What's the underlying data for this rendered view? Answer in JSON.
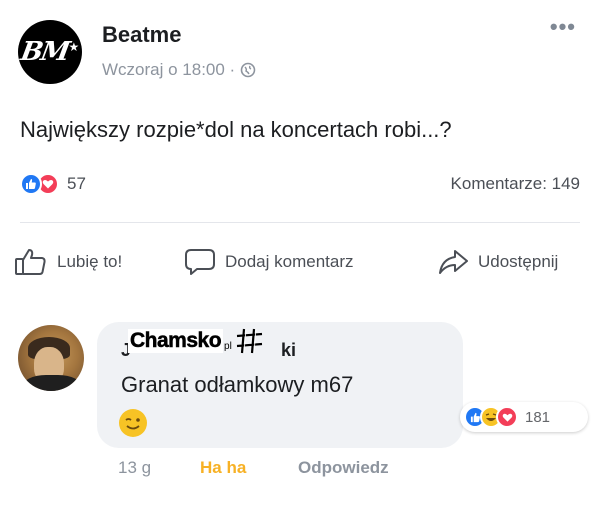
{
  "post": {
    "page_name": "Beatme",
    "logo_text": "BM",
    "timestamp": "Wczoraj o 18:00 ·",
    "text": "Największy rozpie*dol na koncertach robi...?",
    "reaction_count": "57",
    "comments_label": "Komentarze: 149",
    "more_label": "•••"
  },
  "actions": {
    "like": "Lubię to!",
    "comment": "Dodaj komentarz",
    "share": "Udostępnij"
  },
  "comment": {
    "author_prefix": "J",
    "author_suffix": "ki",
    "watermark": "Chamsko",
    "watermark_suffix": "pl",
    "text": "Granat odłamkowy m67",
    "reaction_count": "181",
    "time": "13 g",
    "haha_label": "Ha ha",
    "reply_label": "Odpowiedz"
  },
  "colors": {
    "like_blue": "#2078f4",
    "love_red": "#f33e58",
    "haha_yellow": "#f7b125"
  }
}
